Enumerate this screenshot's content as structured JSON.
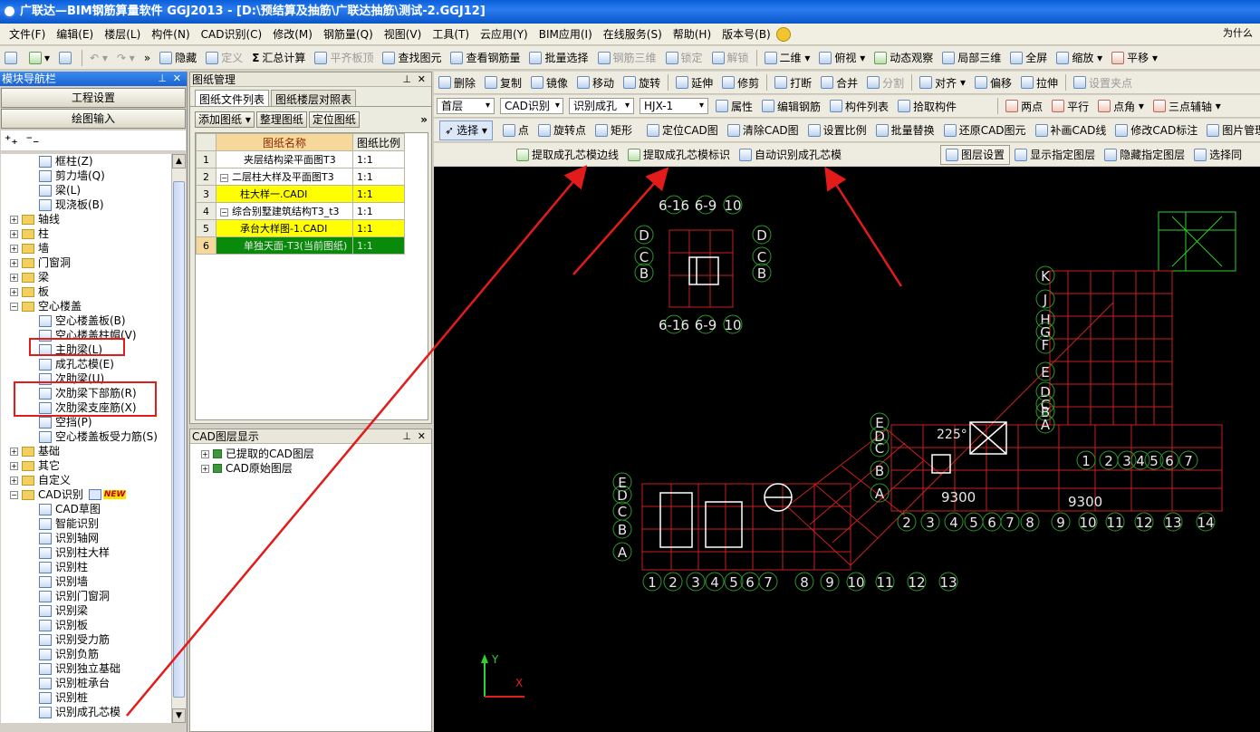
{
  "window": {
    "title": "广联达—BIM钢筋算量软件 GGJ2013 - [D:\\预结算及抽筋\\广联达抽筋\\测试-2.GGJ12]"
  },
  "menu": {
    "items": [
      "文件(F)",
      "编辑(E)",
      "楼层(L)",
      "构件(N)",
      "CAD识别(C)",
      "修改(M)",
      "钢筋量(Q)",
      "视图(V)",
      "工具(T)",
      "云应用(Y)",
      "BIM应用(I)",
      "在线服务(S)",
      "帮助(H)",
      "版本号(B)"
    ],
    "right_text": "为什么"
  },
  "toolbar1": {
    "hide": "隐藏",
    "define": "定义",
    "sum": "汇总计算",
    "flat_slab": "平齐板顶",
    "find": "查找图元",
    "view_rebar": "查看钢筋量",
    "batch_select": "批量选择",
    "rebar_3d": "钢筋三维",
    "lock": "锁定",
    "unlock": "解锁",
    "view2d": "二维",
    "top_view": "俯视",
    "orbit": "动态观察",
    "local3d": "局部三维",
    "full": "全屏",
    "zoom": "缩放",
    "pan": "平移"
  },
  "toolbar2": {
    "delete": "删除",
    "copy": "复制",
    "mirror": "镜像",
    "move": "移动",
    "rotate": "旋转",
    "extend": "延伸",
    "trim": "修剪",
    "break": "打断",
    "merge": "合并",
    "split": "分割",
    "align": "对齐",
    "offset": "偏移",
    "stretch": "拉伸",
    "set_point": "设置夹点"
  },
  "toolbar3": {
    "floor": "首层",
    "cad": "CAD识别",
    "identify": "识别成孔",
    "hjx": "HJX-1",
    "props": "属性",
    "edit_rebar": "编辑钢筋",
    "comp_list": "构件列表",
    "pick": "拾取构件",
    "two_point": "两点",
    "parallel": "平行",
    "point_angle": "点角",
    "three_point": "三点辅轴"
  },
  "toolbar4": {
    "select": "选择",
    "point": "点",
    "rotate_point": "旋转点",
    "rect": "矩形",
    "locate_cad": "定位CAD图",
    "clear_cad": "清除CAD图",
    "set_scale": "设置比例",
    "batch_replace": "批量替换",
    "restore_cad": "还原CAD图元",
    "fill_cad": "补画CAD线",
    "modify_cad": "修改CAD标注",
    "drawing_mgr": "图片管理"
  },
  "toolbar5": {
    "extract_edge": "提取成孔芯模边线",
    "extract_label": "提取成孔芯模标识",
    "auto_identify": "自动识别成孔芯模",
    "layer_set": "图层设置",
    "show_layer": "显示指定图层",
    "hide_layer": "隐藏指定图层",
    "select_same": "选择同"
  },
  "nav": {
    "title": "模块导航栏",
    "btn_project": "工程设置",
    "btn_draw": "绘图输入",
    "tree": [
      {
        "label": "框柱(Z)",
        "level": 2,
        "type": "leaf"
      },
      {
        "label": "剪力墙(Q)",
        "level": 2,
        "type": "leaf"
      },
      {
        "label": "梁(L)",
        "level": 2,
        "type": "leaf"
      },
      {
        "label": "现浇板(B)",
        "level": 2,
        "type": "leaf"
      },
      {
        "label": "轴线",
        "level": 1,
        "type": "folder",
        "sign": "+"
      },
      {
        "label": "柱",
        "level": 1,
        "type": "folder",
        "sign": "+"
      },
      {
        "label": "墙",
        "level": 1,
        "type": "folder",
        "sign": "+"
      },
      {
        "label": "门窗洞",
        "level": 1,
        "type": "folder",
        "sign": "+"
      },
      {
        "label": "梁",
        "level": 1,
        "type": "folder",
        "sign": "+"
      },
      {
        "label": "板",
        "level": 1,
        "type": "folder",
        "sign": "+"
      },
      {
        "label": "空心楼盖",
        "level": 1,
        "type": "folder",
        "sign": "−"
      },
      {
        "label": "空心楼盖板(B)",
        "level": 2,
        "type": "leaf"
      },
      {
        "label": "空心楼盖柱帽(V)",
        "level": 2,
        "type": "leaf"
      },
      {
        "label": "主肋梁(L)",
        "level": 2,
        "type": "leaf"
      },
      {
        "label": "成孔芯模(E)",
        "level": 2,
        "type": "leaf"
      },
      {
        "label": "次肋梁(U)",
        "level": 2,
        "type": "leaf"
      },
      {
        "label": "次肋梁下部筋(R)",
        "level": 2,
        "type": "leaf"
      },
      {
        "label": "次肋梁支座筋(X)",
        "level": 2,
        "type": "leaf"
      },
      {
        "label": "空挡(P)",
        "level": 2,
        "type": "leaf"
      },
      {
        "label": "空心楼盖板受力筋(S)",
        "level": 2,
        "type": "leaf"
      },
      {
        "label": "基础",
        "level": 1,
        "type": "folder",
        "sign": "+"
      },
      {
        "label": "其它",
        "level": 1,
        "type": "folder",
        "sign": "+"
      },
      {
        "label": "自定义",
        "level": 1,
        "type": "folder",
        "sign": "+"
      },
      {
        "label": "CAD识别",
        "level": 1,
        "type": "folder",
        "sign": "−",
        "badge": "NEW"
      },
      {
        "label": "CAD草图",
        "level": 2,
        "type": "leaf"
      },
      {
        "label": "智能识别",
        "level": 2,
        "type": "leaf"
      },
      {
        "label": "识别轴网",
        "level": 2,
        "type": "leaf"
      },
      {
        "label": "识别柱大样",
        "level": 2,
        "type": "leaf"
      },
      {
        "label": "识别柱",
        "level": 2,
        "type": "leaf"
      },
      {
        "label": "识别墙",
        "level": 2,
        "type": "leaf"
      },
      {
        "label": "识别门窗洞",
        "level": 2,
        "type": "leaf"
      },
      {
        "label": "识别梁",
        "level": 2,
        "type": "leaf"
      },
      {
        "label": "识别板",
        "level": 2,
        "type": "leaf"
      },
      {
        "label": "识别受力筋",
        "level": 2,
        "type": "leaf"
      },
      {
        "label": "识别负筋",
        "level": 2,
        "type": "leaf"
      },
      {
        "label": "识别独立基础",
        "level": 2,
        "type": "leaf"
      },
      {
        "label": "识别桩承台",
        "level": 2,
        "type": "leaf"
      },
      {
        "label": "识别桩",
        "level": 2,
        "type": "leaf"
      },
      {
        "label": "识别成孔芯模",
        "level": 2,
        "type": "leaf"
      }
    ]
  },
  "drawings": {
    "title": "图纸管理",
    "tab_files": "图纸文件列表",
    "tab_floor": "图纸楼层对照表",
    "btn_add": "添加图纸",
    "btn_organize": "整理图纸",
    "btn_locate": "定位图纸",
    "col_name": "图纸名称",
    "col_scale": "图纸比例",
    "rows": [
      {
        "no": "1",
        "name": "夹层结构梁平面图T3",
        "scale": "1:1",
        "style": "normal",
        "indent": 0
      },
      {
        "no": "2",
        "name": "二层柱大样及平面图T3",
        "scale": "1:1",
        "style": "normal",
        "indent": 0,
        "sign": "−"
      },
      {
        "no": "3",
        "name": "柱大样一.CADI",
        "scale": "1:1",
        "style": "yellow",
        "indent": 1
      },
      {
        "no": "4",
        "name": "综合别墅建筑结构T3_t3",
        "scale": "1:1",
        "style": "normal",
        "indent": 0,
        "sign": "−"
      },
      {
        "no": "5",
        "name": "承台大样图-1.CADI",
        "scale": "1:1",
        "style": "yellow",
        "indent": 1
      },
      {
        "no": "6",
        "name": "单独天面-T3(当前图纸)",
        "scale": "1:1",
        "style": "green",
        "indent": 0
      }
    ]
  },
  "layers": {
    "title": "CAD图层显示",
    "items": [
      "已提取的CAD图层",
      "CAD原始图层"
    ]
  },
  "canvas": {
    "col_labels_main": [
      "1",
      "2",
      "3",
      "4",
      "5",
      "6",
      "7",
      "8",
      "9",
      "10",
      "11",
      "12",
      "13",
      "14"
    ],
    "row_labels": [
      "A",
      "B",
      "C",
      "D",
      "E"
    ],
    "right_rows": [
      "K",
      "J",
      "H",
      "G",
      "F",
      "E",
      "D",
      "C",
      "B",
      "A"
    ],
    "right_cols": [
      "1",
      "2",
      "3",
      "4",
      "5",
      "6",
      "7"
    ],
    "top_labels": [
      "6-16",
      "6-9",
      "10"
    ],
    "top_side": [
      "D",
      "C",
      "B"
    ],
    "angle": "225°",
    "dims_text": "9300",
    "axis_x": "X",
    "axis_y": "Y"
  }
}
